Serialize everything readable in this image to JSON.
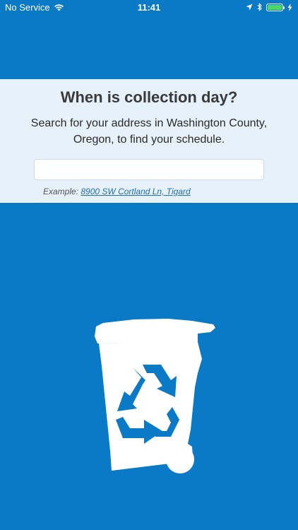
{
  "status_bar": {
    "carrier": "No Service",
    "time": "11:41",
    "icons": [
      "wifi-icon",
      "location-arrow-icon",
      "bluetooth-icon",
      "battery-icon",
      "charging-bolt-icon"
    ],
    "battery_color": "#4cd964"
  },
  "search": {
    "title": "When is collection day?",
    "subtitle": "Search for your address in Washington County, Oregon, to find your schedule.",
    "input_value": "",
    "input_placeholder": "",
    "example_prefix": "Example:",
    "example_link": "8900 SW Cortland Ln, Tigard"
  },
  "illustration": {
    "icon": "recycling-bin-icon",
    "symbol": "recycle-icon"
  },
  "colors": {
    "background": "#0b7ac6",
    "panel": "#e6f1fa",
    "link": "#1f6fb8"
  }
}
